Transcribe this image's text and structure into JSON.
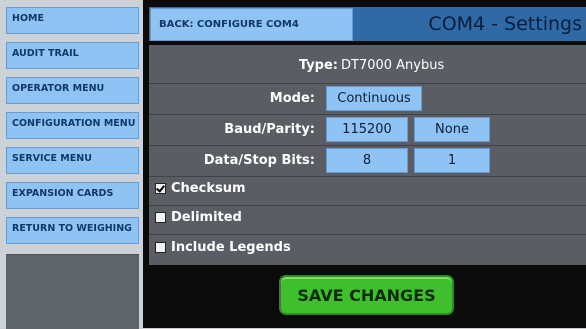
{
  "sidebar": {
    "items": [
      {
        "label": "HOME"
      },
      {
        "label": "AUDIT TRAIL"
      },
      {
        "label": "OPERATOR MENU"
      },
      {
        "label": "CONFIGURATION MENU"
      },
      {
        "label": "SERVICE MENU"
      },
      {
        "label": "EXPANSION CARDS"
      },
      {
        "label": "RETURN TO WEIGHING"
      }
    ]
  },
  "header": {
    "back_label": "BACK: CONFIGURE COM4",
    "title": "COM4 - Settings"
  },
  "settings": {
    "type_label": "Type:",
    "type_value": "DT7000 Anybus",
    "mode_label": "Mode:",
    "mode_value": "Continuous",
    "baud_label": "Baud/Parity:",
    "baud_value": "115200",
    "parity_value": "None",
    "bits_label": "Data/Stop Bits:",
    "data_bits": "8",
    "stop_bits": "1"
  },
  "options": [
    {
      "label": "Checksum",
      "checked": true
    },
    {
      "label": "Delimited",
      "checked": false
    },
    {
      "label": "Include Legends",
      "checked": false
    }
  ],
  "actions": {
    "save_label": "SAVE CHANGES"
  },
  "colors": {
    "button_blue": "#8fc3f3",
    "header_blue": "#2f6aa6",
    "panel_gray": "#5a5e64",
    "save_green": "#3fbf2e"
  }
}
